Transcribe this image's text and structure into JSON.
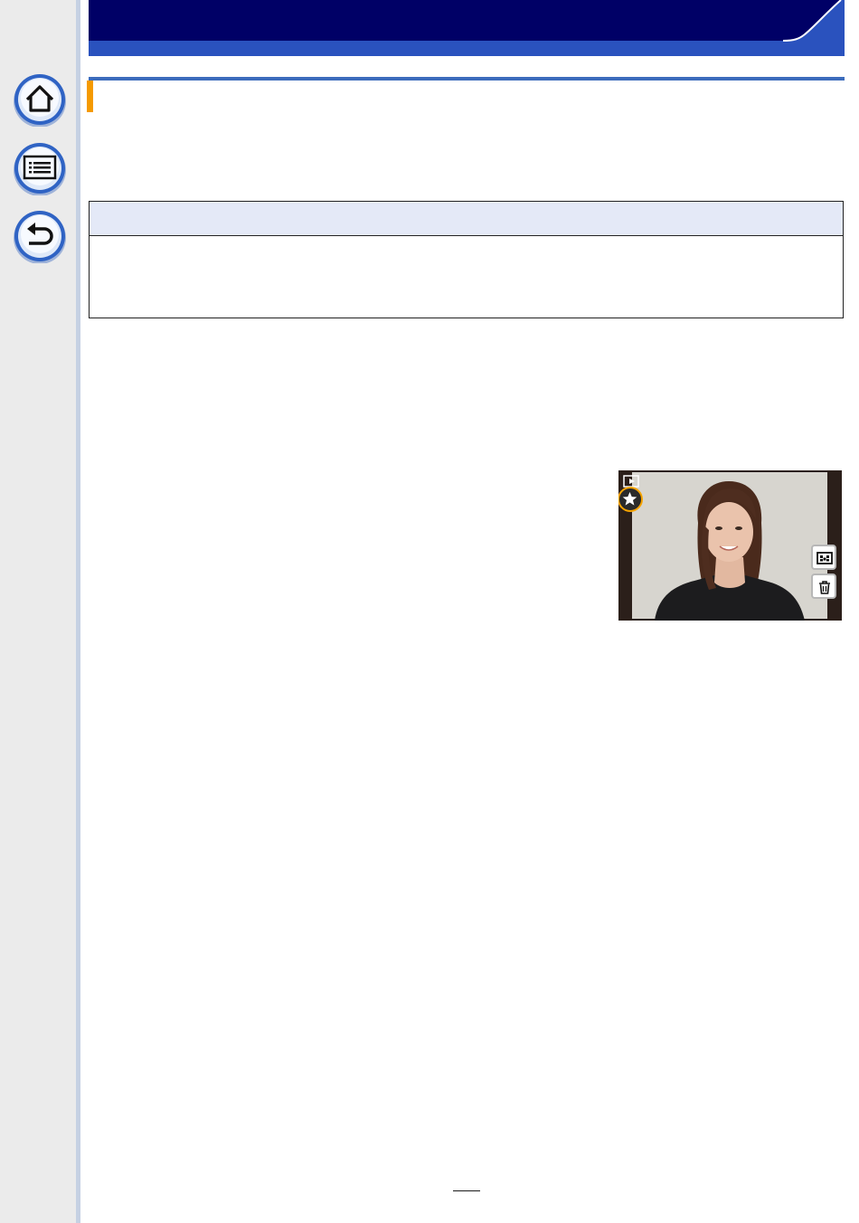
{
  "header": {
    "title": ""
  },
  "section": {
    "title": ""
  },
  "note": {
    "header": "",
    "body": ""
  },
  "page": {
    "number": ""
  },
  "colors": {
    "banner": "#000066",
    "banner_accent": "#2a52be",
    "section_rule": "#3c6cbc",
    "section_marker": "#f59a00",
    "note_header_bg": "#e4e9f7",
    "sidebar_bg": "#ebebeb",
    "favorite_ring": "#f5a300"
  },
  "sidebar": {
    "items": [
      {
        "name": "home",
        "icon": "home-icon"
      },
      {
        "name": "contents",
        "icon": "list-icon"
      },
      {
        "name": "back",
        "icon": "return-icon"
      }
    ]
  },
  "camera_screen": {
    "icons": [
      "playback-icon",
      "favorite-star-icon",
      "filter-icon",
      "trash-icon"
    ]
  }
}
